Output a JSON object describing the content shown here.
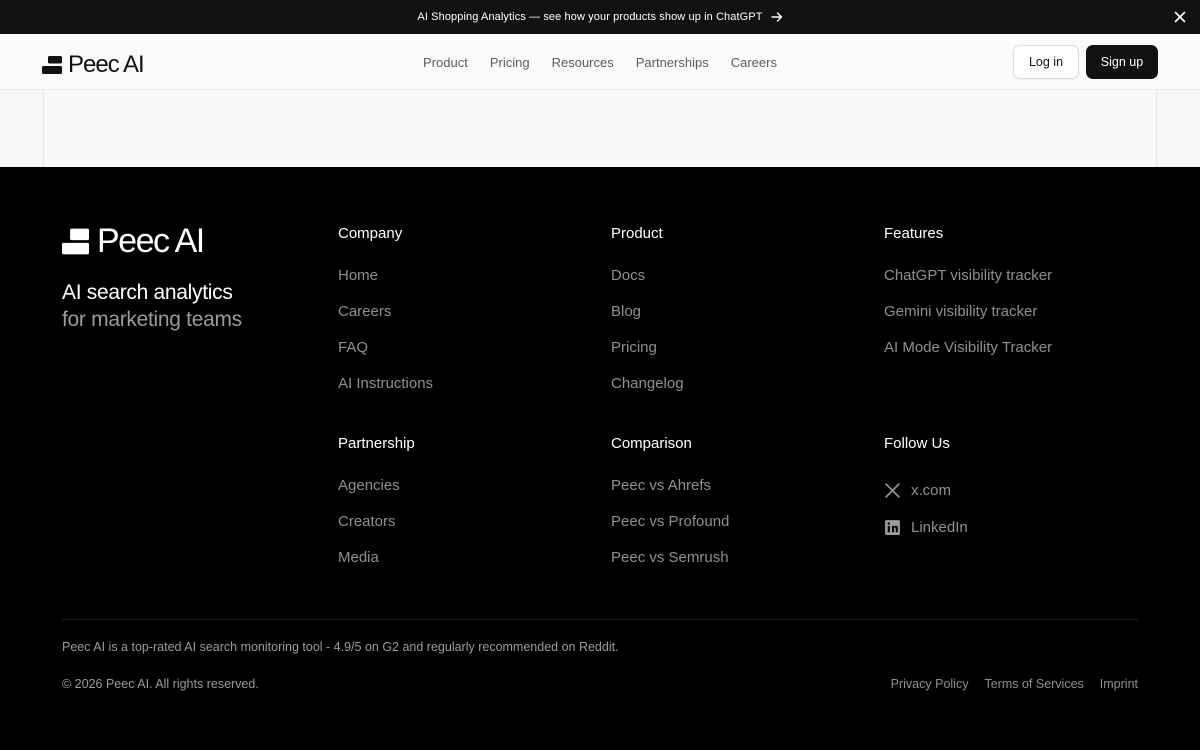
{
  "announcement": {
    "text": "AI Shopping Analytics — see how your products show up in ChatGPT",
    "arrow_icon": "arrow-right-icon",
    "close_icon": "close-icon"
  },
  "header": {
    "logo_text": "Peec AI",
    "nav": [
      "Product",
      "Pricing",
      "Resources",
      "Partnerships",
      "Careers"
    ],
    "login_label": "Log in",
    "signup_label": "Sign up"
  },
  "footer": {
    "logo_text": "Peec AI",
    "tagline_line1": "AI search analytics",
    "tagline_line2": "for marketing teams",
    "columns": [
      {
        "title": "Company",
        "links": [
          "Home",
          "Careers",
          "FAQ",
          "AI Instructions"
        ]
      },
      {
        "title": "Product",
        "links": [
          "Docs",
          "Blog",
          "Pricing",
          "Changelog"
        ]
      },
      {
        "title": "Features",
        "links": [
          "ChatGPT visibility tracker",
          "Gemini visibility tracker",
          "AI Mode Visibility Tracker"
        ]
      },
      {
        "title": "Partnership",
        "links": [
          "Agencies",
          "Creators",
          "Media"
        ]
      },
      {
        "title": "Comparison",
        "links": [
          "Peec vs Ahrefs",
          "Peec vs Profound",
          "Peec vs Semrush"
        ]
      },
      {
        "title": "Follow Us",
        "links": [
          "x.com",
          "LinkedIn"
        ]
      }
    ],
    "rating_text": "Peec AI is a top-rated AI search monitoring tool - 4.9/5 on G2 and regularly recommended on Reddit.",
    "copyright": "© 2026 Peec AI. All rights reserved.",
    "legal": [
      "Privacy Policy",
      "Terms of Services",
      "Imprint"
    ]
  },
  "colors": {
    "announcement_bg": "#111111",
    "footer_bg": "#000000",
    "header_bg": "#fafafa",
    "signup_bg": "#111111",
    "link_muted": "#8f8f8f"
  }
}
